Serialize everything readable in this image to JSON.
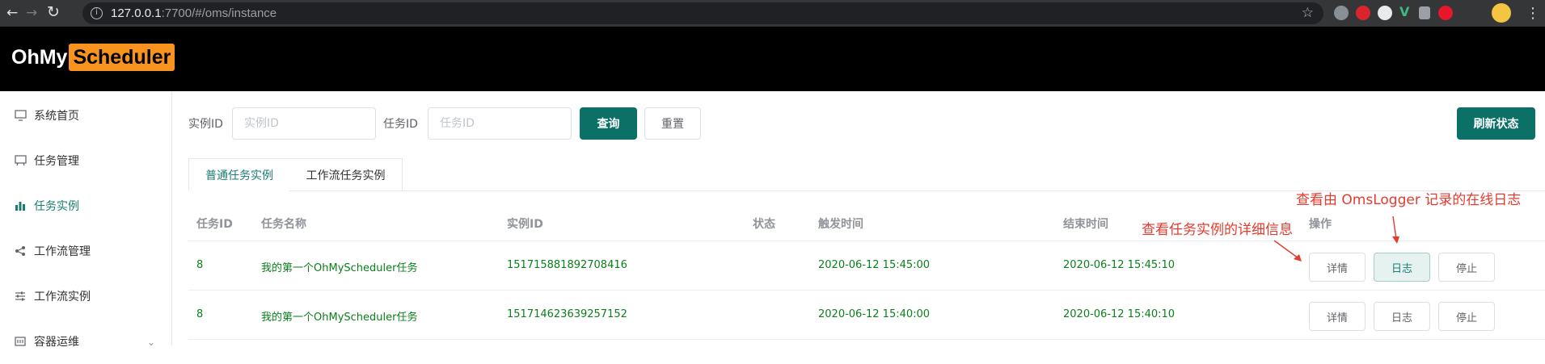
{
  "browser": {
    "back_icon": "←",
    "forward_icon": "→",
    "reload_icon": "↻",
    "url_host": "127.0.0.1",
    "url_rest": ":7700/#/oms/instance",
    "star_icon": "☆",
    "menu_icon": "⋮"
  },
  "app": {
    "logo_part1": "OhMy",
    "logo_part2": "Scheduler"
  },
  "sidebar": {
    "items": [
      {
        "label": "系统首页",
        "icon": "monitor-icon"
      },
      {
        "label": "任务管理",
        "icon": "board-icon"
      },
      {
        "label": "任务实例",
        "icon": "bar-chart-icon",
        "active": true
      },
      {
        "label": "工作流管理",
        "icon": "share-icon"
      },
      {
        "label": "工作流实例",
        "icon": "sliders-icon"
      },
      {
        "label": "容器运维",
        "icon": "container-icon"
      }
    ]
  },
  "search": {
    "instance_label": "实例ID",
    "instance_placeholder": "实例ID",
    "task_label": "任务ID",
    "task_placeholder": "任务ID",
    "query_button": "查询",
    "reset_button": "重置",
    "refresh_button": "刷新状态"
  },
  "tabs": [
    "普通任务实例",
    "工作流任务实例"
  ],
  "table": {
    "headers": [
      "任务ID",
      "任务名称",
      "实例ID",
      "状态",
      "触发时间",
      "结束时间",
      "操作"
    ],
    "rows": [
      {
        "task_id": "8",
        "task_name": "我的第一个OhMyScheduler任务",
        "instance_id": "151715881892708416",
        "status": "",
        "trigger_time": "2020-06-12 15:45:00",
        "end_time": "2020-06-12 15:45:10"
      },
      {
        "task_id": "8",
        "task_name": "我的第一个OhMyScheduler任务",
        "instance_id": "151714623639257152",
        "status": "",
        "trigger_time": "2020-06-12 15:40:00",
        "end_time": "2020-06-12 15:40:10"
      }
    ],
    "actions": {
      "detail": "详情",
      "log": "日志",
      "stop": "停止"
    }
  },
  "annotations": {
    "log_note": "查看由 OmsLogger 记录的在线日志",
    "detail_note": "查看任务实例的详细信息"
  },
  "colors": {
    "accent": "#0b7066",
    "annotation": "#e33b2e",
    "row_text": "#0a7f1a",
    "logo_highlight": "#f7931e"
  }
}
